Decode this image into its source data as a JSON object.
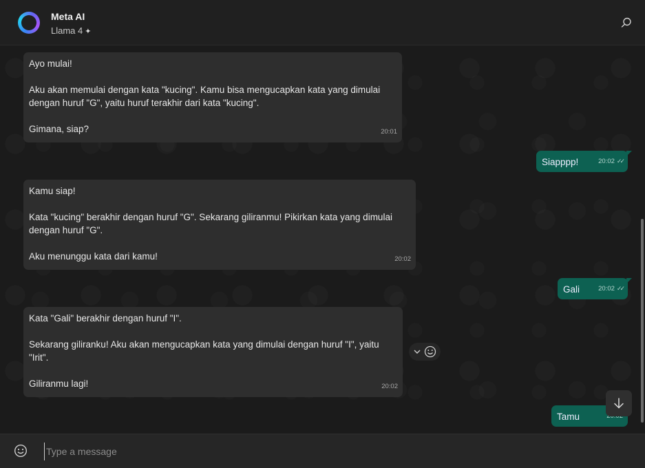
{
  "header": {
    "title": "Meta AI",
    "subtitle": "Llama 4",
    "subtitle_icon": "sparkle-icon"
  },
  "messages": [
    {
      "direction": "in",
      "text": "Ayo mulai!\n\nAku akan memulai dengan kata \"kucing\". Kamu bisa mengucapkan kata yang dimulai\ndengan huruf \"G\", yaitu huruf terakhir dari kata \"kucing\".\n\nGimana, siap?",
      "time": "20:01"
    },
    {
      "direction": "out",
      "text": "Siapppp!",
      "time": "20:02",
      "status": "read"
    },
    {
      "direction": "in",
      "text": "Kamu siap!\n\nKata \"kucing\" berakhir dengan huruf \"G\". Sekarang giliranmu! Pikirkan kata yang dimulai\ndengan huruf \"G\".\n\nAku menunggu kata dari kamu!",
      "time": "20:02"
    },
    {
      "direction": "out",
      "text": "Gali",
      "time": "20:02",
      "status": "read"
    },
    {
      "direction": "in",
      "text": "Kata \"Gali\" berakhir dengan huruf \"I\".\n\nSekarang giliranku! Aku akan mengucapkan kata yang dimulai dengan huruf \"I\", yaitu\n\"Irit\".\n\nGiliranmu lagi!",
      "time": "20:02"
    },
    {
      "direction": "out",
      "text": "Tamu",
      "time": "20:02",
      "status": "sent"
    }
  ],
  "composer": {
    "placeholder": "Type a message"
  },
  "colors": {
    "incoming_bubble": "#2e2e2e",
    "outgoing_bubble": "#0d6152",
    "background": "#1b1b1b"
  }
}
